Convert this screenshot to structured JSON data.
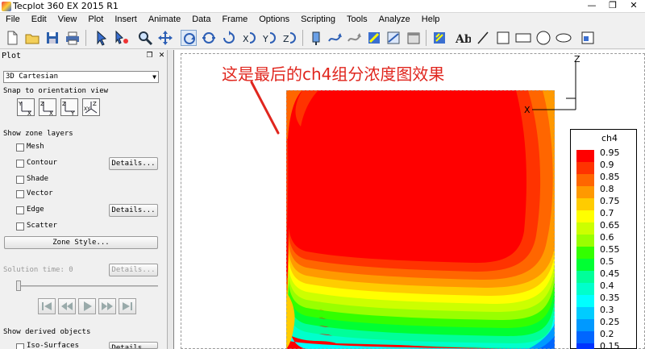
{
  "window": {
    "title": "Tecplot 360 EX 2015 R1",
    "minimize": "—",
    "restore": "❐",
    "close": "✕"
  },
  "menu": [
    "File",
    "Edit",
    "View",
    "Plot",
    "Insert",
    "Animate",
    "Data",
    "Frame",
    "Options",
    "Scripting",
    "Tools",
    "Analyze",
    "Help"
  ],
  "panel": {
    "title": "Plot",
    "plot_type": "3D Cartesian",
    "snap_label": "Snap to orientation view",
    "orient_buttons": [
      {
        "top": "Y",
        "bottom": "X"
      },
      {
        "top": "Z",
        "bottom": "X"
      },
      {
        "top": "Z",
        "bottom": "Y"
      },
      {
        "top": "Z",
        "bottom": "XY"
      }
    ],
    "zone_layers_label": "Show zone layers",
    "layers": {
      "mesh": "Mesh",
      "contour": "Contour",
      "shade": "Shade",
      "vector": "Vector",
      "edge": "Edge",
      "scatter": "Scatter"
    },
    "details_label": "Details...",
    "zone_style_label": "Zone Style...",
    "solution_time_label": "Solution time: 0",
    "derived_label": "Show derived objects",
    "iso_label": "Iso-Surfaces"
  },
  "annotation": "这是最后的ch4组分浓度图效果",
  "axes": {
    "z": "Z",
    "x": "X"
  },
  "legend": {
    "title": "ch4",
    "levels": [
      "0.95",
      "0.9",
      "0.85",
      "0.8",
      "0.75",
      "0.7",
      "0.65",
      "0.6",
      "0.55",
      "0.5",
      "0.45",
      "0.4",
      "0.35",
      "0.3",
      "0.25",
      "0.2",
      "0.15"
    ],
    "colors": [
      "#ff0000",
      "#ff3300",
      "#ff6600",
      "#ff9900",
      "#ffcc00",
      "#ffff00",
      "#ccff00",
      "#99ff00",
      "#33ff00",
      "#00ff33",
      "#00ff99",
      "#00ffcc",
      "#00ffff",
      "#00ccff",
      "#0099ff",
      "#0066ff",
      "#0033ff"
    ]
  }
}
